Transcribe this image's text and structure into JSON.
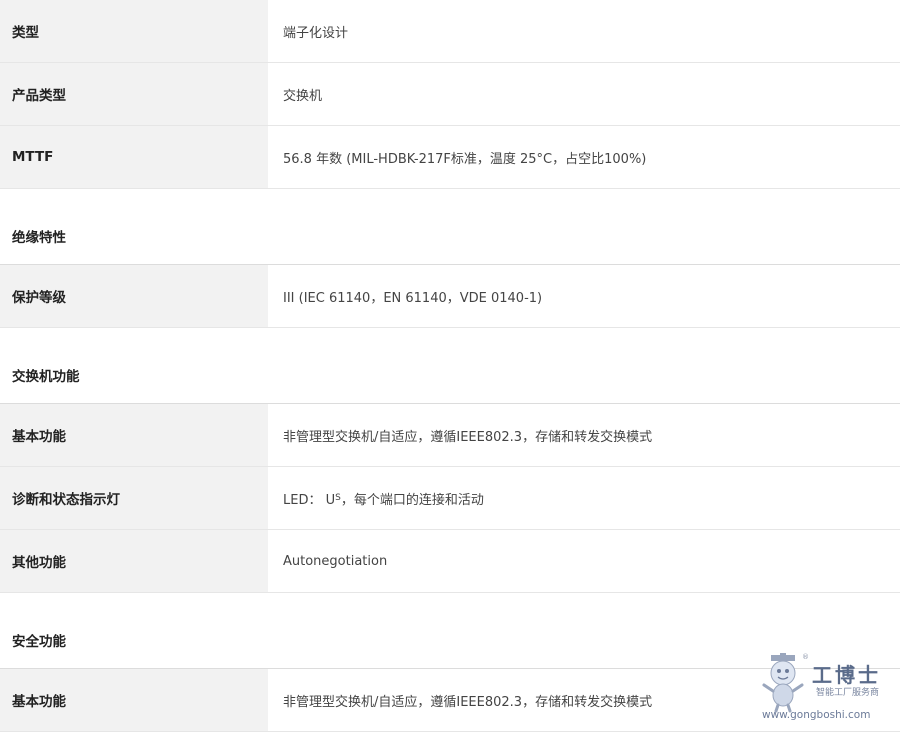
{
  "rows": [
    {
      "type": "row",
      "label": "类型",
      "value": "端子化设计"
    },
    {
      "type": "row",
      "label": "产品类型",
      "value": "交换机"
    },
    {
      "type": "row",
      "label": "MTTF",
      "value": "56.8 年数 (MIL-HDBK-217F标准，温度 25°C，占空比100%)"
    },
    {
      "type": "section",
      "label": "绝缘特性"
    },
    {
      "type": "row",
      "label": "保护等级",
      "value": "III (IEC 61140，EN 61140，VDE 0140-1)"
    },
    {
      "type": "section",
      "label": "交换机功能"
    },
    {
      "type": "row",
      "label": "基本功能",
      "value": "非管理型交换机/自适应，遵循IEEE802.3，存储和转发交换模式"
    },
    {
      "type": "row",
      "label": "诊断和状态指示灯",
      "value_prefix": "LED： U",
      "value_sub": "S",
      "value_suffix": "，每个端口的连接和活动"
    },
    {
      "type": "row",
      "label": "其他功能",
      "value": "Autonegotiation"
    },
    {
      "type": "section",
      "label": "安全功能"
    },
    {
      "type": "row",
      "label": "基本功能",
      "value": "非管理型交换机/自适应，遵循IEEE802.3，存储和转发交换模式"
    }
  ],
  "watermark": {
    "title": "工博士",
    "subtitle": "智能工厂服务商",
    "url": "www.gongboshi.com",
    "registered": "®"
  }
}
